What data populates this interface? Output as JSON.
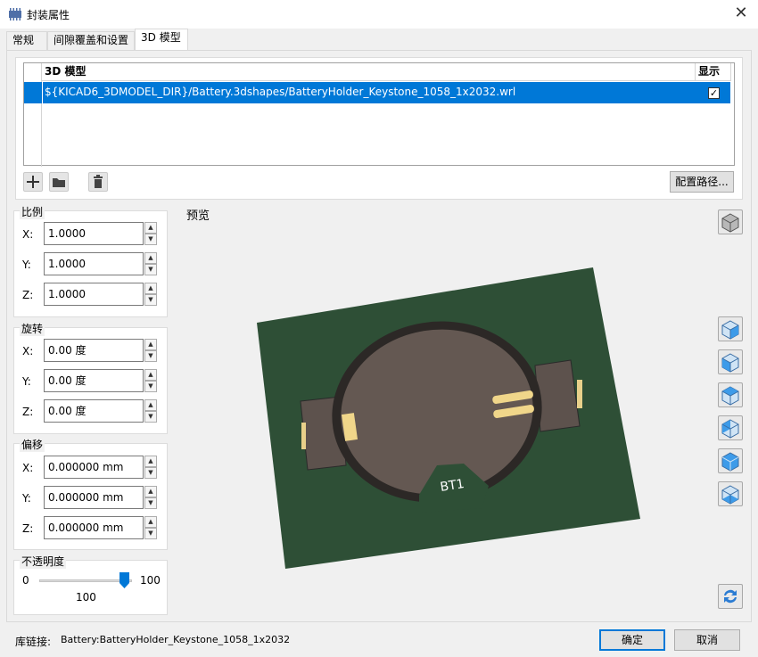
{
  "window": {
    "title": "封装属性",
    "close_label": "✕"
  },
  "tabs": [
    {
      "label": "常规"
    },
    {
      "label": "间隙覆盖和设置"
    },
    {
      "label": "3D 模型"
    }
  ],
  "model_table": {
    "col_model": "3D 模型",
    "col_show": "显示",
    "rows": [
      {
        "path": "${KICAD6_3DMODEL_DIR}/Battery.3dshapes/BatteryHolder_Keystone_1058_1x2032.wrl",
        "shown": true
      }
    ],
    "check_mark": "✓"
  },
  "toolbar": {
    "add_icon": "plus-icon",
    "folder_icon": "folder-icon",
    "delete_icon": "trash-icon",
    "configure_paths_label": "配置路径..."
  },
  "scale": {
    "title": "比例",
    "x_label": "X:",
    "x_value": "1.0000",
    "y_label": "Y:",
    "y_value": "1.0000",
    "z_label": "Z:",
    "z_value": "1.0000"
  },
  "rotation": {
    "title": "旋转",
    "x_label": "X:",
    "x_value": "0.00 度",
    "y_label": "Y:",
    "y_value": "0.00 度",
    "z_label": "Z:",
    "z_value": "0.00 度"
  },
  "offset": {
    "title": "偏移",
    "x_label": "X:",
    "x_value": "0.000000 mm",
    "y_label": "Y:",
    "y_value": "0.000000 mm",
    "z_label": "Z:",
    "z_value": "0.000000 mm"
  },
  "opacity": {
    "title": "不透明度",
    "min_label": "0",
    "max_label": "100",
    "value_label": "100",
    "level": 1.0
  },
  "preview": {
    "label": "预览",
    "silkscreen": "BT1",
    "view_buttons": [
      "cube-3d-icon",
      "view-right-icon",
      "view-front-icon",
      "view-top-icon",
      "view-left-icon",
      "view-back-icon",
      "view-bottom-icon",
      "reload-icon"
    ]
  },
  "footer": {
    "lib_link_label": "库链接:",
    "lib_link_value": "Battery:BatteryHolder_Keystone_1058_1x2032",
    "ok_label": "确定",
    "cancel_label": "取消"
  },
  "colors": {
    "accent": "#0078d7",
    "pcb": "#2e4f36",
    "holder": "#645852",
    "contact": "#f0d68a"
  }
}
